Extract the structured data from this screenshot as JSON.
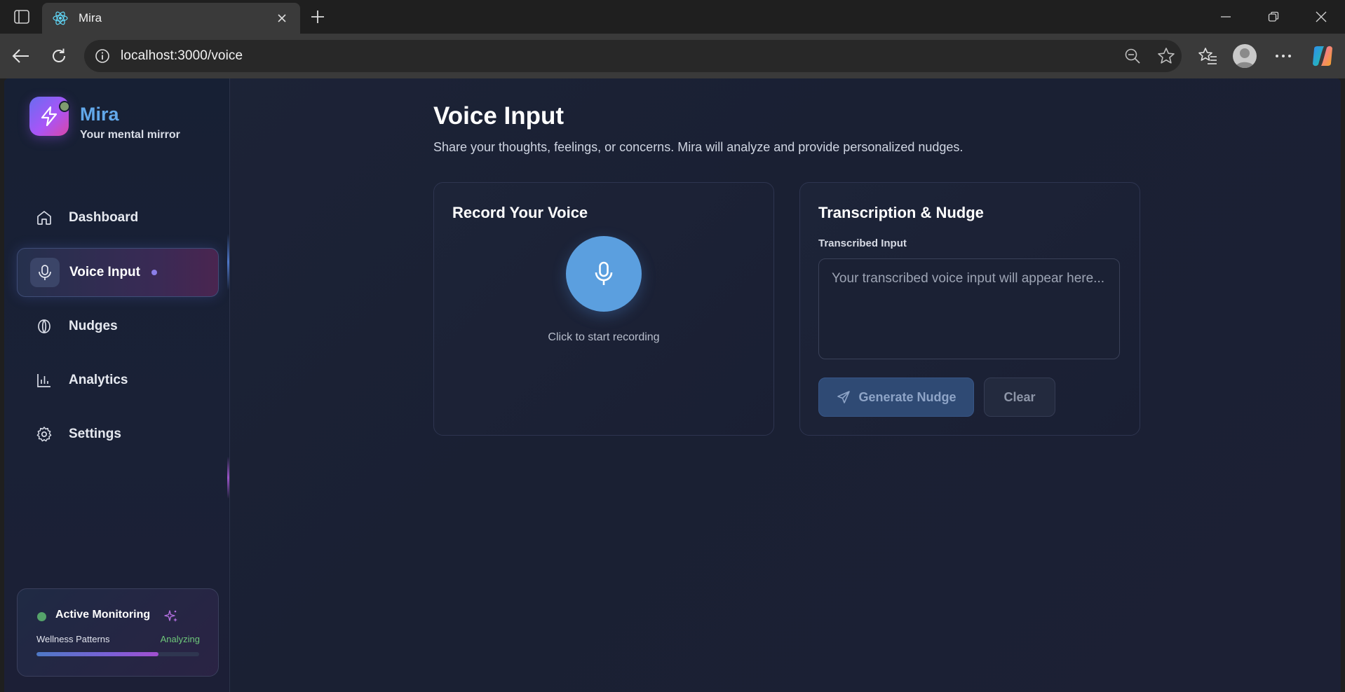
{
  "browser": {
    "tab_title": "Mira",
    "url": "localhost:3000/voice"
  },
  "sidebar": {
    "brand_name": "Mira",
    "brand_tagline": "Your mental mirror",
    "items": [
      {
        "label": "Dashboard",
        "icon": "home-icon"
      },
      {
        "label": "Voice Input",
        "icon": "mic-icon",
        "active": true
      },
      {
        "label": "Nudges",
        "icon": "brain-icon"
      },
      {
        "label": "Analytics",
        "icon": "bar-chart-icon"
      },
      {
        "label": "Settings",
        "icon": "gear-icon"
      }
    ],
    "monitor": {
      "title": "Active Monitoring",
      "label": "Wellness Patterns",
      "status": "Analyzing",
      "progress": 0.75
    }
  },
  "main": {
    "title": "Voice Input",
    "subtitle": "Share your thoughts, feelings, or concerns. Mira will analyze and provide personalized nudges.",
    "record_card": {
      "title": "Record Your Voice",
      "hint": "Click to start recording"
    },
    "transcription_card": {
      "title": "Transcription & Nudge",
      "field_label": "Transcribed Input",
      "placeholder": "Your transcribed voice input will appear here...",
      "value": "",
      "generate_label": "Generate Nudge",
      "clear_label": "Clear"
    }
  },
  "colors": {
    "accent_blue": "#5b9fdf",
    "brand_text": "#62a8ea",
    "status_green": "#6ec77a",
    "page_bg": "#1a2033"
  }
}
